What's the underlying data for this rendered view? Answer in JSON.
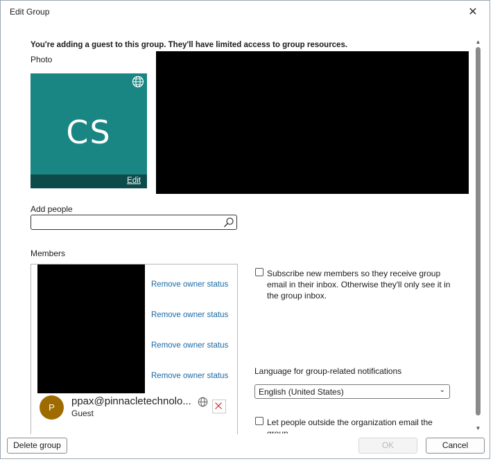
{
  "window": {
    "title": "Edit Group",
    "close_glyph": "✕"
  },
  "banner": "You're adding a guest to this group. They'll have limited access to group resources.",
  "photo": {
    "label": "Photo",
    "initials": "CS",
    "edit_label": "Edit",
    "bg_color": "#198683"
  },
  "add_people": {
    "label": "Add people",
    "value": "",
    "placeholder": ""
  },
  "members": {
    "label": "Members",
    "remove_owner_links": [
      "Remove owner status",
      "Remove owner status",
      "Remove owner status",
      "Remove owner status"
    ],
    "guest": {
      "initial": "P",
      "email": "ppax@pinnacletechnolo...",
      "role": "Guest"
    }
  },
  "subscribe": {
    "checked": false,
    "text": "Subscribe new members so they receive group email in their inbox. Otherwise they'll only see it in the group inbox."
  },
  "language": {
    "label": "Language for group-related notifications",
    "selected": "English (United States)"
  },
  "outside_email": {
    "checked": false,
    "text": "Let people outside the organization email the group"
  },
  "buttons": {
    "delete": "Delete group",
    "ok": "OK",
    "cancel": "Cancel"
  }
}
